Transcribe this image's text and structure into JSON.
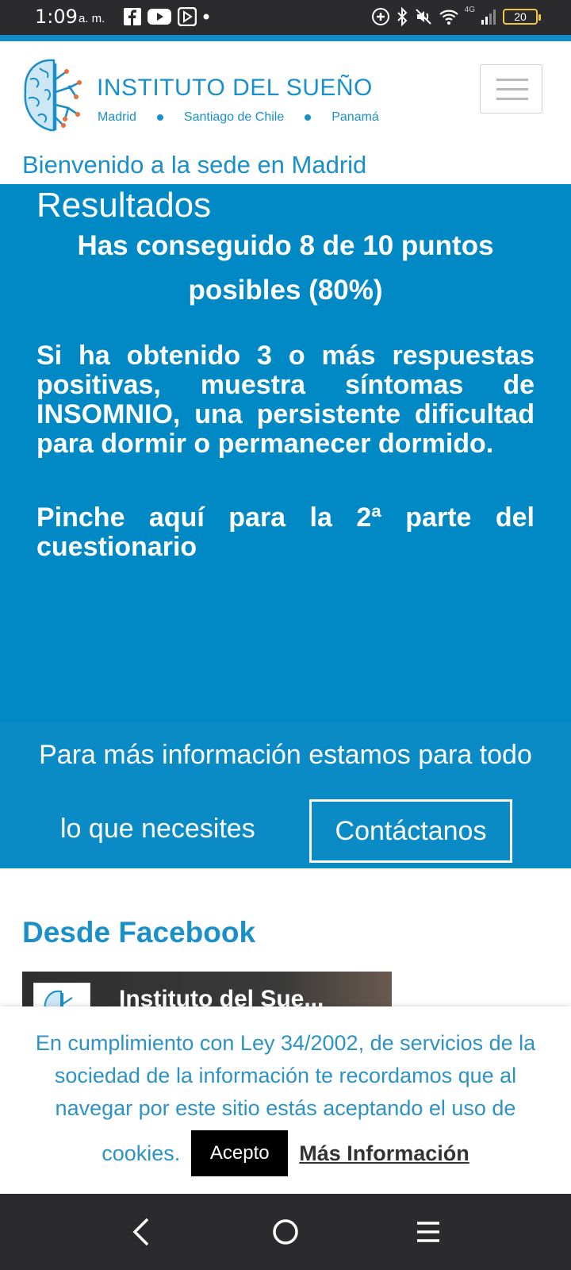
{
  "status_bar": {
    "time": "1:09",
    "ampm": "a. m.",
    "network": "4G",
    "battery": "20"
  },
  "header": {
    "title": "INSTITUTO DEL SUEÑO",
    "cities": [
      "Madrid",
      "Santiago de Chile",
      "Panamá"
    ],
    "welcome": "Bienvenido a la sede en Madrid"
  },
  "results": {
    "title": "Resultados",
    "score_line1": "Has conseguido 8 de 10 puntos",
    "score_line2": "posibles (80%)",
    "message": "Si ha obtenido 3 o más respuestas positivas, muestra síntomas de INSOMNIO, una persistente dificultad para dormir o permanecer dormido.",
    "second_part_link": "Pinche aquí para la 2ª parte del cuestionario"
  },
  "contact": {
    "line1": "Para más información estamos para todo",
    "line2": "lo que necesites",
    "button": "Contáctanos"
  },
  "facebook": {
    "heading": "Desde Facebook",
    "page_name": "Instituto del Sue..."
  },
  "cookie": {
    "text": "En cumplimiento con Ley 34/2002, de servicios de la sociedad de la información te recordamos que al navegar por este sitio estás aceptando el uso de",
    "tail": "cookies.",
    "accept": "Acepto",
    "more_info": "Más Información"
  },
  "colors": {
    "brand_blue": "#1a8fc9",
    "panel_blue": "#0089c4",
    "system_bar": "#2b2b2e"
  }
}
